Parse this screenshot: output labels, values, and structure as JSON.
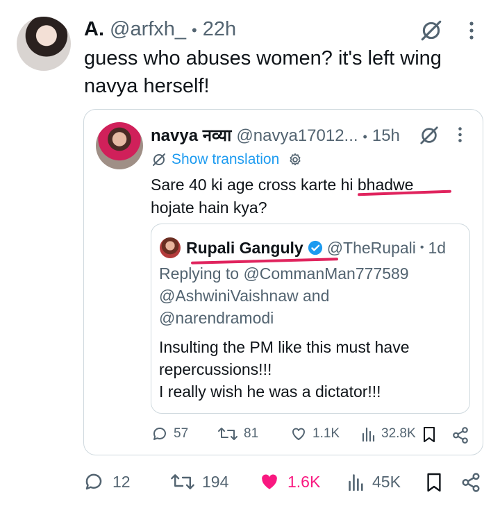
{
  "tweet": {
    "display_name": "A.",
    "handle": "@arfxh_",
    "dot": "•",
    "time": "22h",
    "text_line1": "guess who abuses women? it's left wing",
    "text_line2": "navya herself!",
    "actions": {
      "replies": "12",
      "retweets": "194",
      "likes": "1.6K",
      "views": "45K"
    }
  },
  "quoted": {
    "display_name": "navya नव्या",
    "handle": "@navya17012...",
    "dot": "•",
    "time": "15h",
    "translation_label": "Show translation",
    "text_line1": "Sare 40 ki age cross karte hi bhadwe",
    "text_line2": "hojate hain kya?",
    "actions": {
      "replies": "57",
      "retweets": "81",
      "likes": "1.1K",
      "views": "32.8K"
    }
  },
  "inner": {
    "display_name": "Rupali Ganguly",
    "handle": "@TheRupali",
    "dot": "•",
    "time": "1d",
    "replying_line1": "Replying to @CommanMan777589",
    "replying_line2": "@AshwiniVaishnaw and",
    "replying_line3": "@narendramodi",
    "text_line1": "Insulting the PM like this must have",
    "text_line2": "repercussions!!!",
    "text_line3": "I really wish he was a dictator!!!"
  },
  "colors": {
    "like_active": "#f91880",
    "verified": "#1d9bf0",
    "highlight_underline": "#e0245e",
    "link": "#1d9bf0"
  },
  "icons": [
    "grok-icon",
    "more-icon",
    "translate-icon",
    "gear-icon",
    "verified-icon",
    "reply-icon",
    "retweet-icon",
    "heart-icon",
    "views-icon",
    "bookmark-icon",
    "share-icon"
  ]
}
